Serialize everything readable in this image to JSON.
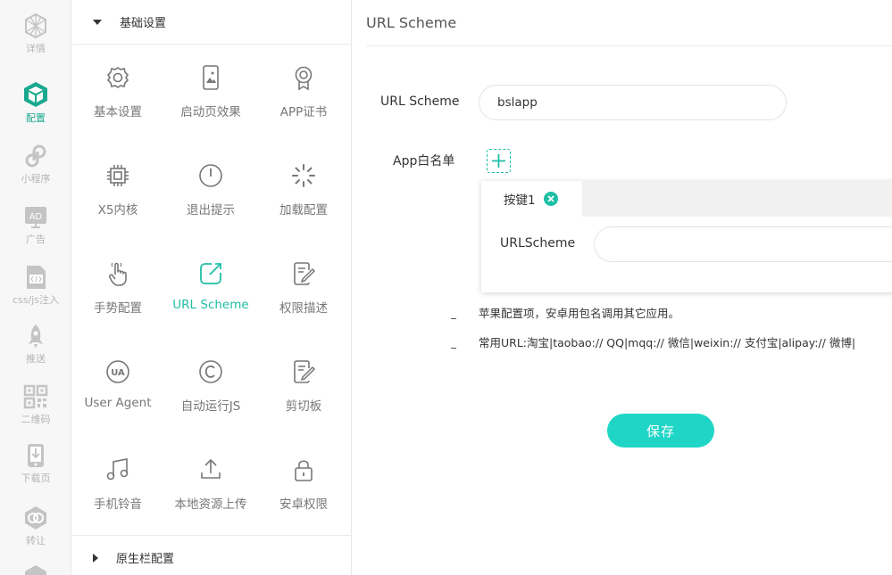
{
  "rail": {
    "items": [
      {
        "label": "详情",
        "icon": "globe-icon"
      },
      {
        "label": "配置",
        "icon": "cube-icon"
      },
      {
        "label": "小程序",
        "icon": "mini-program-icon"
      },
      {
        "label": "广告",
        "icon": "ad-icon"
      },
      {
        "label": "css/js注入",
        "icon": "code-file-icon"
      },
      {
        "label": "推送",
        "icon": "rocket-icon"
      },
      {
        "label": "二维码",
        "icon": "qrcode-icon"
      },
      {
        "label": "下载页",
        "icon": "download-page-icon"
      },
      {
        "label": "转让",
        "icon": "transfer-icon"
      }
    ],
    "active_color": "#1aa98f",
    "inactive_color": "#b5b5b5"
  },
  "panel": {
    "section_basic": "基础设置",
    "section_native": "原生栏配置",
    "features": [
      {
        "label": "基本设置",
        "icon": "gear-icon"
      },
      {
        "label": "启动页效果",
        "icon": "launch-screen-icon"
      },
      {
        "label": "APP证书",
        "icon": "certificate-icon"
      },
      {
        "label": "X5内核",
        "icon": "chip-icon"
      },
      {
        "label": "退出提示",
        "icon": "power-icon"
      },
      {
        "label": "加载配置",
        "icon": "loading-icon"
      },
      {
        "label": "手势配置",
        "icon": "hand-pointer-icon"
      },
      {
        "label": "URL Scheme",
        "icon": "url-scheme-icon"
      },
      {
        "label": "权限描述",
        "icon": "edit-doc-icon"
      },
      {
        "label": "User Agent",
        "icon": "ua-icon"
      },
      {
        "label": "自动运行JS",
        "icon": "copyright-icon"
      },
      {
        "label": "剪切板",
        "icon": "clipboard-edit-icon"
      },
      {
        "label": "手机铃音",
        "icon": "music-icon"
      },
      {
        "label": "本地资源上传",
        "icon": "upload-icon"
      },
      {
        "label": "安卓权限",
        "icon": "lock-icon"
      }
    ],
    "active_feature": "URL Scheme"
  },
  "main": {
    "title": "URL Scheme",
    "url_scheme_label": "URL Scheme",
    "url_scheme_value": "bslapp",
    "whitelist_label": "App白名单",
    "tab_label": "按键1",
    "urlscheme_field_label": "URLScheme",
    "urlscheme_field_value": "",
    "hint_1": "苹果配置项，安卓用包名调用其它应用。",
    "hint_2": "常用URL:淘宝|taobao:// QQ|mqq:// 微信|weixin:// 支付宝|alipay:// 微博|",
    "save_label": "保存"
  },
  "colors": {
    "accent": "#1ebfa5",
    "save_button": "#1fd6c6"
  }
}
